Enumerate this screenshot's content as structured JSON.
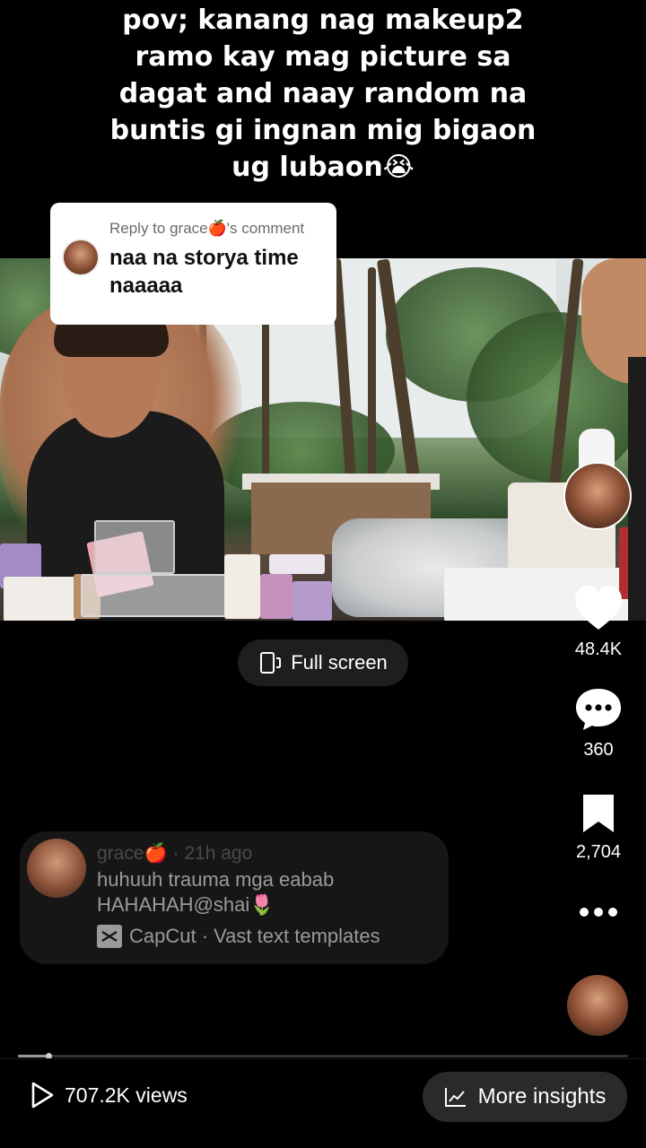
{
  "caption": {
    "lines": [
      "pov; kanang nag makeup2",
      "ramo kay mag picture sa",
      "dagat and naay random na",
      "buntis gi ingnan mig bigaon",
      "ug lubaon😭"
    ]
  },
  "reply": {
    "label": "Reply to grace🍎's comment",
    "text": "naa na storya time naaaaa"
  },
  "fullscreen": {
    "label": "Full screen"
  },
  "rail": {
    "likes": "48.4K",
    "comments": "360",
    "saves": "2,704"
  },
  "comment": {
    "meta": "grace🍎 · 21h ago",
    "text": "huhuuh trauma mga eabab HAHAHAH@shai🌷",
    "template": "CapCut · Vast text templates"
  },
  "playback": {
    "progress_fraction": 0.05
  },
  "stats": {
    "views": "707.2K views",
    "insights_label": "More insights"
  },
  "colors": {
    "background": "#000000",
    "like_heart": "#ffffff",
    "card_bg": "#161616"
  },
  "icons": [
    "heart-icon",
    "comment-icon",
    "bookmark-icon",
    "more-icon",
    "play-icon",
    "chart-icon",
    "fullscreen-icon",
    "capcut-icon"
  ]
}
